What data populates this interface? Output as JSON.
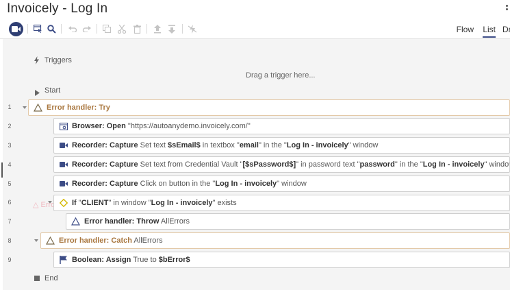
{
  "window": {
    "title": "Invoicely - Log In"
  },
  "tabs": [
    {
      "label": "Flow",
      "active": false
    },
    {
      "label": "List",
      "active": true
    },
    {
      "label": "Dr",
      "active": false
    }
  ],
  "toolbar_icons": [
    "record-icon",
    "select-window-icon",
    "search-icon",
    "undo-icon",
    "redo-icon",
    "copy-icon",
    "cut-icon",
    "delete-icon",
    "move-up-icon",
    "move-down-icon",
    "disable-icon"
  ],
  "sections": {
    "triggers": "Triggers",
    "drag_hint": "Drag a trigger here...",
    "start": "Start",
    "end": "End"
  },
  "steps": [
    {
      "num": "1",
      "parts": [
        [
          "o",
          "Error handler: Try"
        ]
      ]
    },
    {
      "num": "2",
      "parts": [
        [
          "b",
          "Browser: Open"
        ],
        [
          "n",
          " \"https://autoanydemo.invoicely.com/\""
        ]
      ]
    },
    {
      "num": "3",
      "parts": [
        [
          "b",
          "Recorder: Capture"
        ],
        [
          "n",
          " Set text "
        ],
        [
          "b",
          "$sEmail$"
        ],
        [
          "n",
          " in textbox \""
        ],
        [
          "b",
          "email"
        ],
        [
          "n",
          "\" in the \""
        ],
        [
          "b",
          "Log In - invoicely"
        ],
        [
          "n",
          "\" window"
        ]
      ]
    },
    {
      "num": "4",
      "parts": [
        [
          "b",
          "Recorder: Capture"
        ],
        [
          "n",
          " Set text from Credential Vault \""
        ],
        [
          "b",
          "[$sPassword$]"
        ],
        [
          "n",
          "\" in password text \""
        ],
        [
          "b",
          "password"
        ],
        [
          "n",
          "\" in the \""
        ],
        [
          "b",
          "Log In - invoicely"
        ],
        [
          "n",
          "\" window"
        ]
      ]
    },
    {
      "num": "5",
      "parts": [
        [
          "b",
          "Recorder: Capture"
        ],
        [
          "n",
          " Click on button in the \""
        ],
        [
          "b",
          "Log In - invoicely"
        ],
        [
          "n",
          "\" window"
        ]
      ]
    },
    {
      "num": "6",
      "parts": [
        [
          "b",
          "If"
        ],
        [
          "n",
          " \""
        ],
        [
          "b",
          "CLIENT"
        ],
        [
          "n",
          "\" in window \""
        ],
        [
          "b",
          "Log In - invoicely"
        ],
        [
          "n",
          "\" exists"
        ]
      ]
    },
    {
      "num": "7",
      "parts": [
        [
          "b",
          "Error handler: Throw"
        ],
        [
          "n",
          " AllErrors"
        ]
      ]
    },
    {
      "num": "8",
      "parts": [
        [
          "o",
          "Error handler: Catch"
        ],
        [
          "n",
          " AllErrors"
        ]
      ]
    },
    {
      "num": "9",
      "parts": [
        [
          "b",
          "Boolean: Assign"
        ],
        [
          "n",
          " True to "
        ],
        [
          "b",
          "$bError$"
        ]
      ]
    }
  ],
  "colors": {
    "accent": "#3c4c86",
    "error_handler": "#a9773f",
    "if_icon": "#d4b800"
  }
}
